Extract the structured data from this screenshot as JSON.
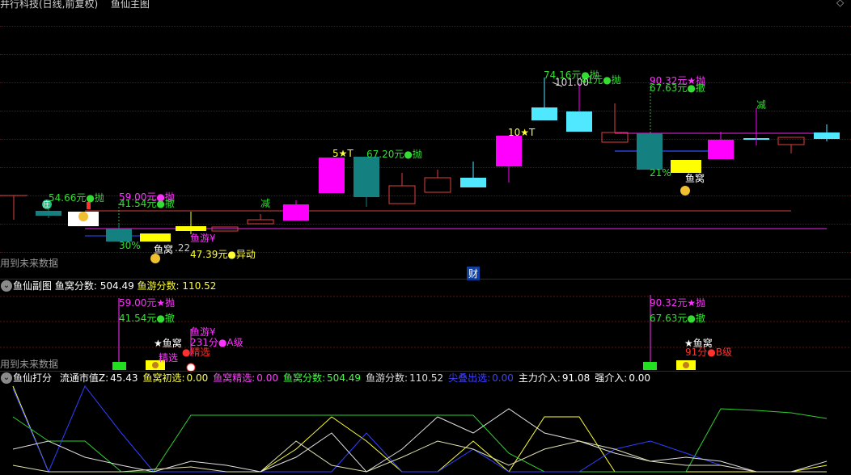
{
  "title_bar": {
    "stock": "井行科技(日线,前复权)",
    "panel": "鱼仙主图"
  },
  "main": {
    "watermark": "用到未来数据",
    "cai": "财",
    "labels": {
      "p_5466": "54.66元●抛",
      "zhuang": "庄",
      "p_5900a": "59.00元●抛",
      "p_4154a": "41.54元●撤",
      "pct30": "30%",
      "yuwo1": "鱼窝",
      "v122": ".22",
      "yuyou": "鱼游¥",
      "p_4739": "47.39元●异动",
      "jian1": "减",
      "s5t": "5★T",
      "p_6720": "67.20元●抛",
      "s10t": "10★T",
      "p_7416": "74.16元●抛",
      "v10100": "101.00",
      "p_41b": "41元●抛",
      "p_9032": "90.32元★抛",
      "p_6763": "67.63元●撤",
      "pct21": "21%",
      "yuwo2": "鱼窝",
      "jian2": "减"
    }
  },
  "sub": {
    "title": "鱼仙副图",
    "s1_label": "鱼窝分数:",
    "s1_val": "504.49",
    "s2_label": "鱼游分数:",
    "s2_val": "110.52",
    "watermark": "用到未来数据",
    "labels": {
      "p_5900": "59.00元★抛",
      "p_4154": "41.54元●撤",
      "yuwo": "★鱼窝",
      "jingxuan": "精选",
      "yuyou": "鱼游¥",
      "a231": "231分●A级",
      "jing2": "●精选",
      "p_9032": "90.32元★抛",
      "p_6763": "67.63元●撤",
      "yuwo2": "★鱼窝",
      "b91": "91分●B级"
    }
  },
  "score": {
    "title": "鱼仙打分",
    "items": [
      {
        "k": "流通市值Z:",
        "v": "45.43",
        "color": "#ffffff"
      },
      {
        "k": "鱼窝初选:",
        "v": "0.00",
        "color": "#ffff40"
      },
      {
        "k": "鱼窝精选:",
        "v": "0.00",
        "color": "#ff40ff"
      },
      {
        "k": "鱼窝分数:",
        "v": "504.49",
        "color": "#40ff40"
      },
      {
        "k": "鱼游分数:",
        "v": "110.52",
        "color": "#dcdcdc"
      },
      {
        "k": "尖叠出选:",
        "v": "0.00",
        "color": "#4040ff"
      },
      {
        "k": "主力介入:",
        "v": "91.08",
        "color": "#ffffff"
      },
      {
        "k": "强介入:",
        "v": "0.00",
        "color": "#ffffff"
      }
    ]
  },
  "colors": {
    "up_magenta": "#ff00ff",
    "up_cyan": "#4fe8ff",
    "teal": "#158080",
    "yellow": "#ffff00",
    "red_outline": "#e24040",
    "green_text": "#33dd33",
    "magenta_text": "#ff33ff"
  }
}
